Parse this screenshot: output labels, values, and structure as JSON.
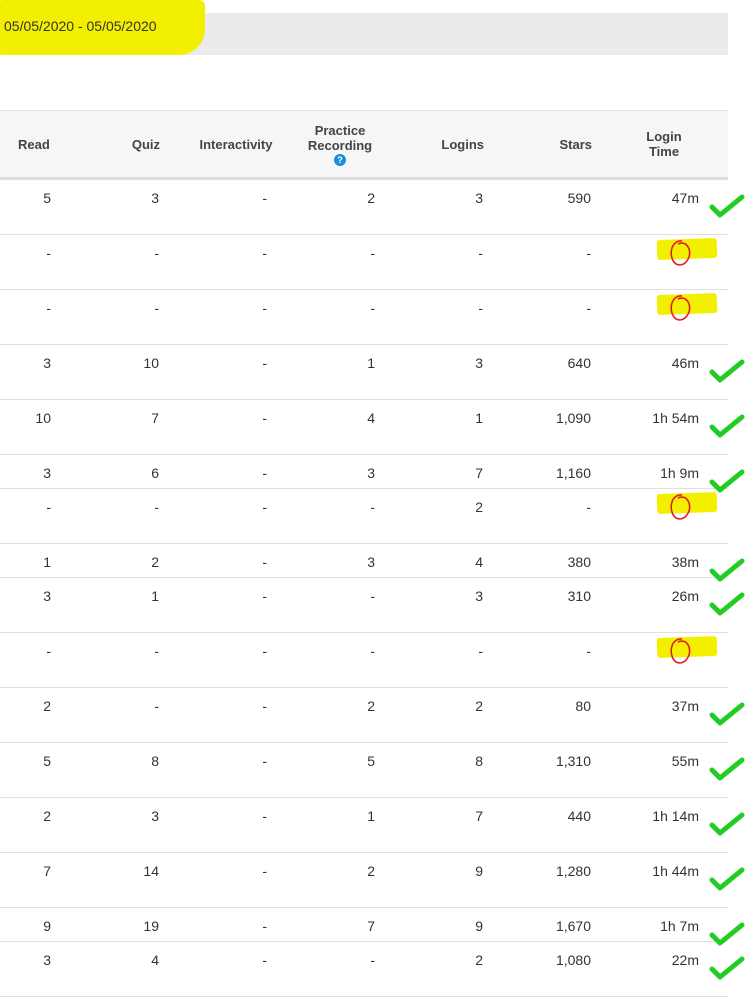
{
  "date_range": "05/05/2020 - 05/05/2020",
  "columns": [
    {
      "key": "read",
      "label": "Read",
      "sub": ""
    },
    {
      "key": "quiz",
      "label": "Quiz",
      "sub": ""
    },
    {
      "key": "interactivity",
      "label": "Interactivity",
      "sub": ""
    },
    {
      "key": "practice",
      "label": "Practice",
      "sub": "Recording"
    },
    {
      "key": "logins",
      "label": "Logins",
      "sub": ""
    },
    {
      "key": "stars",
      "label": "Stars",
      "sub": ""
    },
    {
      "key": "login_time",
      "label": "Login",
      "sub": "Time"
    }
  ],
  "help_icon": "question-circle-icon",
  "colors": {
    "highlight": "#f2ef00",
    "check": "#22cc22",
    "circle": "#e02020",
    "help": "#1e8fd6"
  },
  "rows": [
    {
      "read": "5",
      "quiz": "3",
      "interactivity": "-",
      "practice": "2",
      "logins": "3",
      "stars": "590",
      "login_time": "47m",
      "mark": "check"
    },
    {
      "read": "-",
      "quiz": "-",
      "interactivity": "-",
      "practice": "-",
      "logins": "-",
      "stars": "-",
      "login_time": "-",
      "mark": "circle"
    },
    {
      "read": "-",
      "quiz": "-",
      "interactivity": "-",
      "practice": "-",
      "logins": "-",
      "stars": "-",
      "login_time": "-",
      "mark": "circle"
    },
    {
      "read": "3",
      "quiz": "10",
      "interactivity": "-",
      "practice": "1",
      "logins": "3",
      "stars": "640",
      "login_time": "46m",
      "mark": "check"
    },
    {
      "read": "10",
      "quiz": "7",
      "interactivity": "-",
      "practice": "4",
      "logins": "1",
      "stars": "1,090",
      "login_time": "1h 54m",
      "mark": "check"
    },
    {
      "read": "3",
      "quiz": "6",
      "interactivity": "-",
      "practice": "3",
      "logins": "7",
      "stars": "1,160",
      "login_time": "1h 9m",
      "mark": "check"
    },
    {
      "read": "-",
      "quiz": "-",
      "interactivity": "-",
      "practice": "-",
      "logins": "2",
      "stars": "-",
      "login_time": "-",
      "mark": "circle"
    },
    {
      "read": "1",
      "quiz": "2",
      "interactivity": "-",
      "practice": "3",
      "logins": "4",
      "stars": "380",
      "login_time": "38m",
      "mark": "check"
    },
    {
      "read": "3",
      "quiz": "1",
      "interactivity": "-",
      "practice": "-",
      "logins": "3",
      "stars": "310",
      "login_time": "26m",
      "mark": "check"
    },
    {
      "read": "-",
      "quiz": "-",
      "interactivity": "-",
      "practice": "-",
      "logins": "-",
      "stars": "-",
      "login_time": "-",
      "mark": "circle"
    },
    {
      "read": "2",
      "quiz": "-",
      "interactivity": "-",
      "practice": "2",
      "logins": "2",
      "stars": "80",
      "login_time": "37m",
      "mark": "check"
    },
    {
      "read": "5",
      "quiz": "8",
      "interactivity": "-",
      "practice": "5",
      "logins": "8",
      "stars": "1,310",
      "login_time": "55m",
      "mark": "check"
    },
    {
      "read": "2",
      "quiz": "3",
      "interactivity": "-",
      "practice": "1",
      "logins": "7",
      "stars": "440",
      "login_time": "1h 14m",
      "mark": "check"
    },
    {
      "read": "7",
      "quiz": "14",
      "interactivity": "-",
      "practice": "2",
      "logins": "9",
      "stars": "1,280",
      "login_time": "1h 44m",
      "mark": "check"
    },
    {
      "read": "9",
      "quiz": "19",
      "interactivity": "-",
      "practice": "7",
      "logins": "9",
      "stars": "1,670",
      "login_time": "1h 7m",
      "mark": "check"
    },
    {
      "read": "3",
      "quiz": "4",
      "interactivity": "-",
      "practice": "-",
      "logins": "2",
      "stars": "1,080",
      "login_time": "22m",
      "mark": "check"
    }
  ]
}
